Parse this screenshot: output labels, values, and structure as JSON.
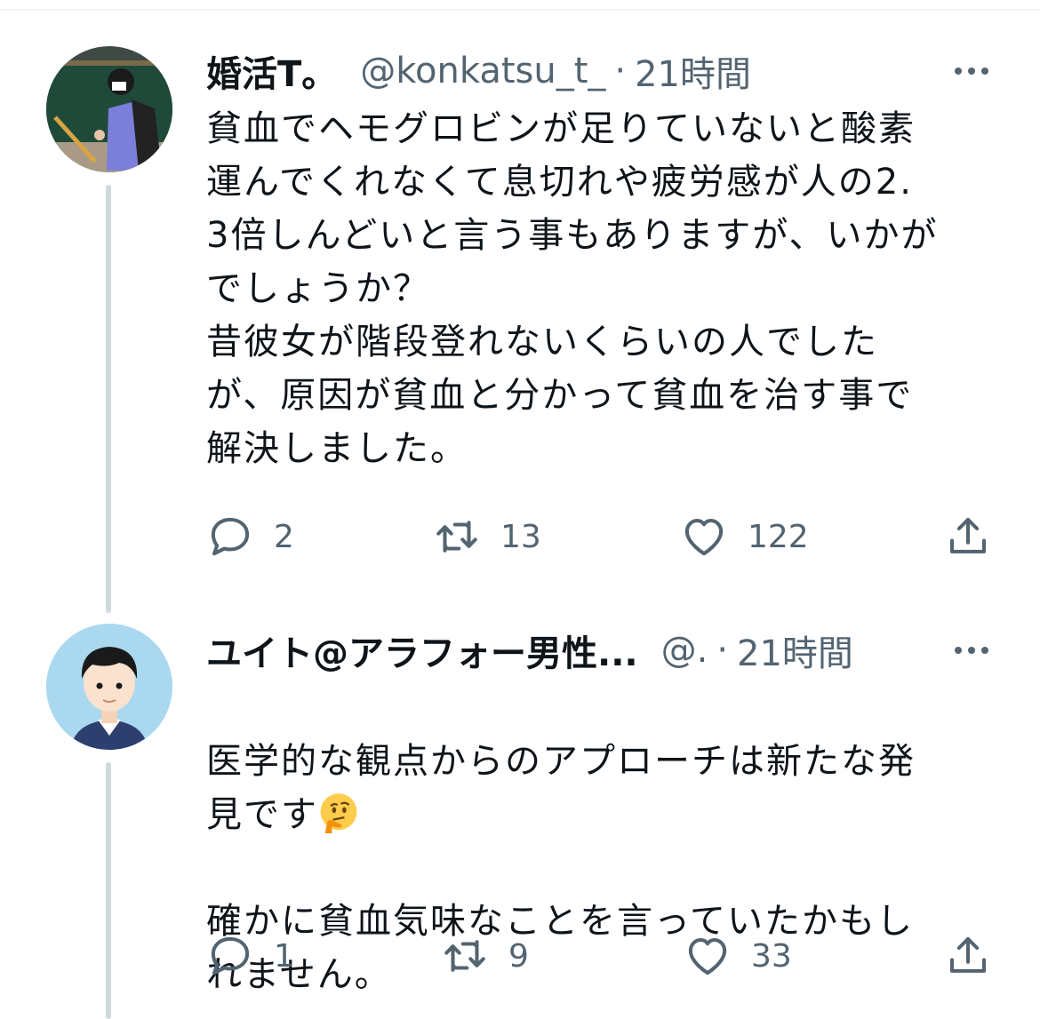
{
  "tweets": [
    {
      "name": "婚活T。",
      "handle": "@konkatsu_t_",
      "separator": "·",
      "time": "21時間",
      "text": "貧血でヘモグロビンが足りていないと酸素\n運んでくれなくて息切れや疲労感が人の2.\n3倍しんどいと言う事もありますが、いかが\nでしょうか？\n昔彼女が階段登れないくらいの人でした\nが、原因が貧血と分かって貧血を治す事で\n解決しました。",
      "replies": "2",
      "retweets": "13",
      "likes": "122"
    },
    {
      "name": "ユイト@アラフォー男性...",
      "handle": "@.",
      "separator": "·",
      "time": "21時間",
      "text_before_emoji": "医学的な観点からのアプローチは新たな発\n見です",
      "emoji": "thinking-face-emoji",
      "text_after_emoji": "確かに貧血気味なことを言っていたかもし\nれません。",
      "replies": "1",
      "retweets": "9",
      "likes": "33"
    }
  ],
  "icons": {
    "reply": "reply-icon",
    "retweet": "retweet-icon",
    "like": "heart-icon",
    "share": "share-icon",
    "more": "more-options-icon"
  },
  "colors": {
    "text": "#0f1419",
    "secondary": "#536471",
    "thread_line": "#cfd9de"
  }
}
